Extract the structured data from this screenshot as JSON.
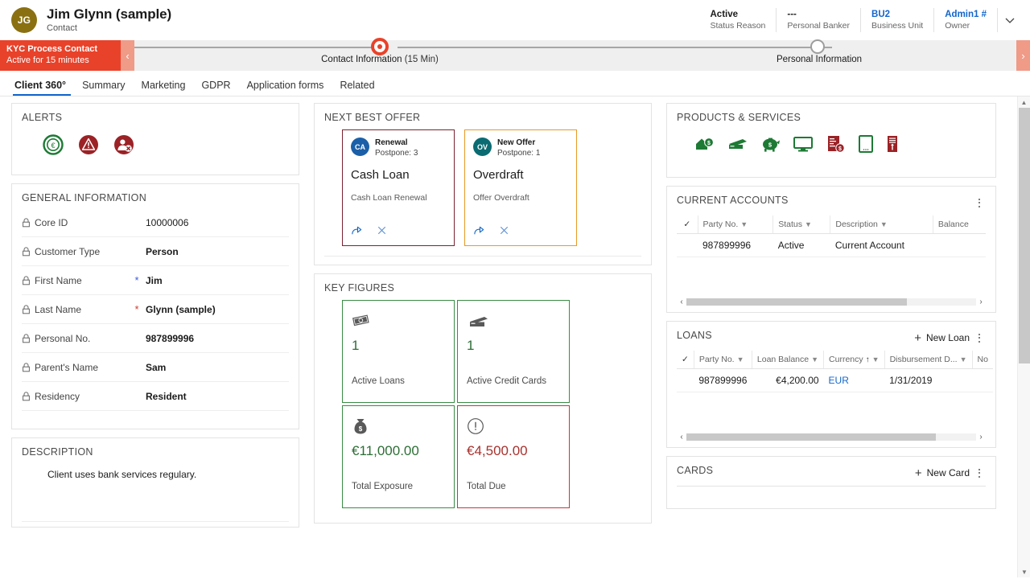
{
  "header": {
    "avatar_initials": "JG",
    "record_title": "Jim Glynn (sample)",
    "record_subtitle": "Contact",
    "fields": [
      {
        "value": "Active",
        "label": "Status Reason",
        "link": false
      },
      {
        "value": "---",
        "label": "Personal Banker",
        "link": false
      },
      {
        "value": "BU2",
        "label": "Business Unit",
        "link": true
      },
      {
        "value": "Admin1 #",
        "label": "Owner",
        "link": true
      }
    ],
    "expand_icon": "chevron-down-icon"
  },
  "process_flow": {
    "stage_name": "KYC Process Contact",
    "stage_status": "Active for 15 minutes",
    "prev_icon": "chevron-left-icon",
    "next_icon": "chevron-right-icon",
    "steps": [
      {
        "label": "Contact Information",
        "duration": "(15 Min)",
        "state": "active"
      },
      {
        "label": "Personal Information",
        "duration": "",
        "state": "pending"
      }
    ]
  },
  "tabs": [
    {
      "label": "Client 360°",
      "active": true
    },
    {
      "label": "Summary",
      "active": false
    },
    {
      "label": "Marketing",
      "active": false
    },
    {
      "label": "GDPR",
      "active": false
    },
    {
      "label": "Application forms",
      "active": false
    },
    {
      "label": "Related",
      "active": false
    }
  ],
  "alerts": {
    "title": "ALERTS",
    "items": [
      {
        "icon": "euro-coin-icon",
        "color": "#1d7a34"
      },
      {
        "icon": "warning-triangle-icon",
        "color": "#9b2226"
      },
      {
        "icon": "person-blocked-icon",
        "color": "#9b2226"
      }
    ]
  },
  "general_information": {
    "title": "GENERAL INFORMATION",
    "rows": [
      {
        "label": "Core ID",
        "value": "10000006",
        "locked": true,
        "required": "",
        "bold": false
      },
      {
        "label": "Customer Type",
        "value": "Person",
        "locked": true,
        "required": "",
        "bold": true
      },
      {
        "label": "First Name",
        "value": "Jim",
        "locked": true,
        "required": "blue",
        "bold": true
      },
      {
        "label": "Last Name",
        "value": "Glynn (sample)",
        "locked": true,
        "required": "red",
        "bold": true
      },
      {
        "label": "Personal No.",
        "value": "987899996",
        "locked": true,
        "required": "",
        "bold": false
      },
      {
        "label": "Parent's Name",
        "value": "Sam",
        "locked": true,
        "required": "",
        "bold": true
      },
      {
        "label": "Residency",
        "value": "Resident",
        "locked": true,
        "required": "",
        "bold": true
      }
    ]
  },
  "description": {
    "title": "DESCRIPTION",
    "text": "Client uses bank services regulary."
  },
  "next_best_offer": {
    "title": "NEXT BEST OFFER",
    "offers": [
      {
        "badge": "CA",
        "badge_color": "#1b5fa8",
        "border": "#7a2230",
        "kind": "Renewal",
        "postpone": "Postpone: 3",
        "name": "Cash Loan",
        "description": "Cash Loan Renewal",
        "actions": [
          "share-icon",
          "dismiss-icon"
        ]
      },
      {
        "badge": "OV",
        "badge_color": "#0b6b72",
        "border": "#e89a27",
        "kind": "New Offer",
        "postpone": "Postpone: 1",
        "name": "Overdraft",
        "description": "Offer Overdraft",
        "actions": [
          "share-icon",
          "dismiss-icon"
        ]
      }
    ]
  },
  "key_figures": {
    "title": "KEY FIGURES",
    "tiles": [
      {
        "icon": "banknotes-icon",
        "value": "1",
        "label": "Active Loans",
        "accent": "green"
      },
      {
        "icon": "credit-card-icon",
        "value": "1",
        "label": "Active Credit Cards",
        "accent": "green"
      },
      {
        "icon": "money-bag-icon",
        "value": "€11,000.00",
        "label": "Total Exposure",
        "accent": "green"
      },
      {
        "icon": "exclamation-circle-icon",
        "value": "€4,500.00",
        "label": "Total Due",
        "accent": "red"
      }
    ]
  },
  "products_services": {
    "title": "PRODUCTS & SERVICES",
    "items": [
      {
        "icon": "home-loan-icon",
        "color": "#1d7a34"
      },
      {
        "icon": "credit-card-icon",
        "color": "#1d7a34"
      },
      {
        "icon": "piggy-bank-icon",
        "color": "#1d7a34"
      },
      {
        "icon": "desktop-icon",
        "color": "#1d7a34"
      },
      {
        "icon": "invoice-icon",
        "color": "#9b2226"
      },
      {
        "icon": "tablet-icon",
        "color": "#1d7a34"
      },
      {
        "icon": "atm-icon",
        "color": "#9b2226"
      }
    ]
  },
  "current_accounts": {
    "title": "CURRENT ACCOUNTS",
    "kebab_icon": "more-options-icon",
    "columns": [
      "Party No.",
      "Status",
      "Description",
      "Balance"
    ],
    "rows": [
      {
        "party_no": "987899996",
        "status": "Active",
        "description": "Current Account",
        "balance": ""
      }
    ],
    "hscroll_thumb_pct": 76
  },
  "loans": {
    "title": "LOANS",
    "new_label": "New Loan",
    "plus_icon": "plus-icon",
    "kebab_icon": "more-options-icon",
    "columns": [
      "Party No.",
      "Loan Balance",
      "Currency",
      "Disbursement D...",
      "No"
    ],
    "sorted_column": "Currency",
    "sort_direction": "asc",
    "rows": [
      {
        "party_no": "987899996",
        "loan_balance": "€4,200.00",
        "currency": "EUR",
        "disbursement_date": "1/31/2019"
      }
    ],
    "hscroll_thumb_pct": 86
  },
  "cards": {
    "title": "CARDS",
    "new_label": "New Card",
    "plus_icon": "plus-icon",
    "kebab_icon": "more-options-icon"
  },
  "scrollbar": {
    "up_icon": "caret-up-icon",
    "down_icon": "caret-down-icon"
  }
}
